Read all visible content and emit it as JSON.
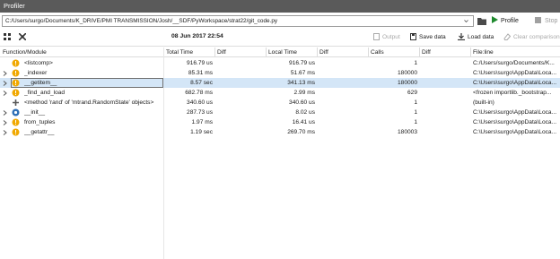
{
  "window": {
    "title": "Profiler"
  },
  "toolbar": {
    "path": "C:/Users/surgo/Documents/K_DRIVE/PMI TRANSMISSION/Josh/__SDF/PyWorkspace/strat22/git_code.py",
    "profile_label": "Profile",
    "stop_label": "Stop",
    "datetime": "08 Jun 2017 22:54",
    "output_label": "Output",
    "save_label": "Save data",
    "load_label": "Load data",
    "clear_label": "Clear comparison"
  },
  "table": {
    "headers": {
      "function": "Function/Module",
      "total_time": "Total Time",
      "diff1": "Diff",
      "local_time": "Local Time",
      "diff2": "Diff",
      "calls": "Calls",
      "diff3": "Diff",
      "fileline": "File:line"
    },
    "rows": [
      {
        "name": "<listcomp>",
        "total": "916.79 us",
        "local": "916.79 us",
        "calls": "1",
        "file": "C:/Users/surgo/Documents/K...",
        "icon": "warning-icon",
        "expand": false
      },
      {
        "name": "_indexer",
        "total": "85.31 ms",
        "local": "51.67 ms",
        "calls": "180000",
        "file": "C:\\Users\\surgo\\AppData\\Loca...",
        "icon": "warning-icon",
        "expand": true
      },
      {
        "name": "__getitem__",
        "total": "8.57 sec",
        "local": "341.13 ms",
        "calls": "180000",
        "file": "C:\\Users\\surgo\\AppData\\Loca...",
        "icon": "warning-icon",
        "expand": true
      },
      {
        "name": "_find_and_load",
        "total": "682.78 ms",
        "local": "2.99 ms",
        "calls": "629",
        "file": "<frozen importlib._bootstrap...",
        "icon": "warning-icon",
        "expand": true
      },
      {
        "name": "<method 'rand' of 'mtrand.RandomState' objects>",
        "total": "340.60 us",
        "local": "340.60 us",
        "calls": "1",
        "file": "(built-in)",
        "icon": "builtin-icon",
        "expand": false
      },
      {
        "name": "__init__",
        "total": "287.73 us",
        "local": "8.02 us",
        "calls": "1",
        "file": "C:\\Users\\surgo\\AppData\\Loca...",
        "icon": "python-icon",
        "expand": true
      },
      {
        "name": "from_tuples",
        "total": "1.97 ms",
        "local": "16.41 us",
        "calls": "1",
        "file": "C:\\Users\\surgo\\AppData\\Loca...",
        "icon": "warning-icon",
        "expand": true
      },
      {
        "name": "__getattr__",
        "total": "1.19 sec",
        "local": "269.70 ms",
        "calls": "180003",
        "file": "C:\\Users\\surgo\\AppData\\Loca...",
        "icon": "warning-icon",
        "expand": true
      }
    ]
  },
  "colors": {
    "warning": "#f0a800",
    "python": "#2f6fb5",
    "selected": "#d4e6f7",
    "titlebar": "#5a5a5a",
    "play": "#1f8a2e"
  }
}
